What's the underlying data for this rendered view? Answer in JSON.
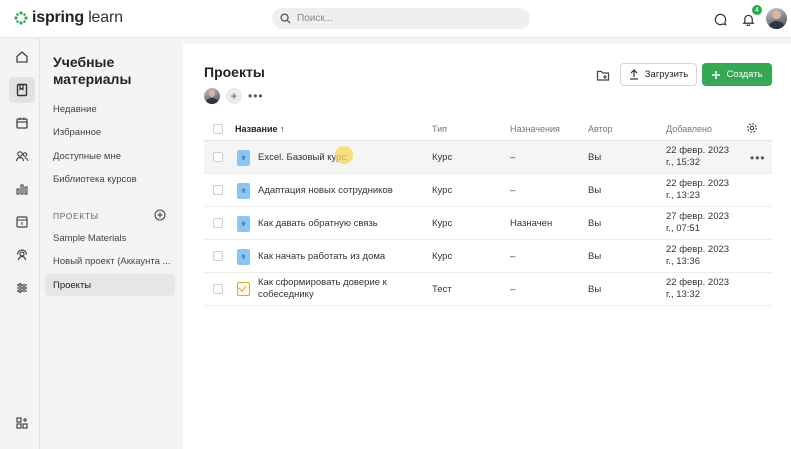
{
  "header": {
    "logo_text_bold": "ispring",
    "logo_text_light": "learn",
    "search": {
      "placeholder": "Поиск..."
    },
    "notifications_count": "4",
    "icons": [
      "chat-icon",
      "bell-icon",
      "user-avatar"
    ]
  },
  "rail": {
    "items": [
      "home-icon",
      "book-icon",
      "calendar-icon",
      "users-icon",
      "chart-icon",
      "portal-icon",
      "support-icon",
      "settings-sliders-icon",
      "apps-icon"
    ]
  },
  "sidebar": {
    "title": "Учебные материалы",
    "links": [
      "Недавние",
      "Избранное",
      "Доступные мне",
      "Библиотека курсов"
    ],
    "section_label": "ПРОЕКТЫ",
    "projects": [
      "Sample Materials",
      "Новый проект (Аккаунта ...",
      "Проекты"
    ]
  },
  "main": {
    "title": "Проекты",
    "upload_label": "Загрузить",
    "create_label": "Создать"
  },
  "table": {
    "headers": {
      "name": "Название",
      "type": "Тип",
      "assign": "Назначения",
      "author": "Автор",
      "added": "Добавлено"
    },
    "rows": [
      {
        "name": "Excel. Базовый курс",
        "type": "Курс",
        "assign": "–",
        "author": "Вы",
        "date1": "22 февр. 2023",
        "date2": "г., 15:32",
        "icon": "course-file-icon"
      },
      {
        "name": "Адаптация новых сотрудников",
        "type": "Курс",
        "assign": "–",
        "author": "Вы",
        "date1": "22 февр. 2023",
        "date2": "г., 13:23",
        "icon": "course-file-icon"
      },
      {
        "name": "Как давать обратную связь",
        "type": "Курс",
        "assign": "Назначен",
        "author": "Вы",
        "date1": "27 февр. 2023",
        "date2": "г., 07:51",
        "icon": "course-file-icon"
      },
      {
        "name": "Как начать работать из дома",
        "type": "Курс",
        "assign": "–",
        "author": "Вы",
        "date1": "22 февр. 2023",
        "date2": "г., 13:36",
        "icon": "course-file-icon"
      },
      {
        "name": "Как сформировать доверие к собеседнику",
        "type": "Тест",
        "assign": "–",
        "author": "Вы",
        "date1": "22 февр. 2023",
        "date2": "г., 13:32",
        "icon": "test-check-icon"
      }
    ]
  },
  "colors": {
    "brand_green": "#34a853",
    "logo_green": "#2fa84f"
  }
}
